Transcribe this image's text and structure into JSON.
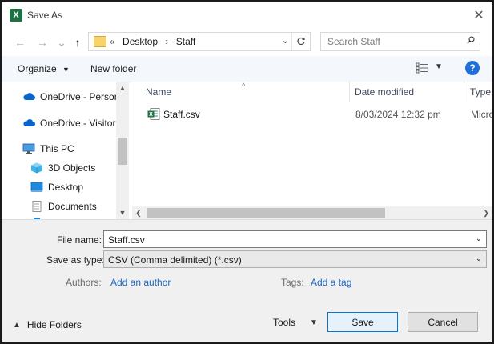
{
  "window": {
    "title": "Save As",
    "app_icon": "excel-icon"
  },
  "nav": {
    "breadcrumbs": [
      "«",
      "Desktop",
      "Staff"
    ],
    "search_placeholder": "Search Staff"
  },
  "toolbar": {
    "organize_label": "Organize",
    "new_folder_label": "New folder"
  },
  "navpane": {
    "items": [
      {
        "label": "OneDrive - Person",
        "icon": "cloud-icon"
      },
      {
        "label": "OneDrive - Visitor",
        "icon": "cloud-icon"
      },
      {
        "label": "This PC",
        "icon": "computer-icon"
      },
      {
        "label": "3D Objects",
        "icon": "cube-icon"
      },
      {
        "label": "Desktop",
        "icon": "desktop-icon"
      },
      {
        "label": "Documents",
        "icon": "document-icon"
      }
    ]
  },
  "files": {
    "columns": [
      "Name",
      "Date modified",
      "Type"
    ],
    "rows": [
      {
        "name": "Staff.csv",
        "date": "8/03/2024 12:32 pm",
        "type": "Micro"
      }
    ]
  },
  "form": {
    "file_name_label": "File name:",
    "file_name_value": "Staff.csv",
    "save_type_label": "Save as type:",
    "save_type_value": "CSV (Comma delimited) (*.csv)",
    "authors_label": "Authors:",
    "authors_link": "Add an author",
    "tags_label": "Tags:",
    "tags_link": "Add a tag"
  },
  "footer": {
    "hide_folders_label": "Hide Folders",
    "tools_label": "Tools",
    "save_label": "Save",
    "cancel_label": "Cancel"
  },
  "colors": {
    "link": "#1a66c9",
    "accent": "#0078d7",
    "excel": "#1e7145"
  }
}
